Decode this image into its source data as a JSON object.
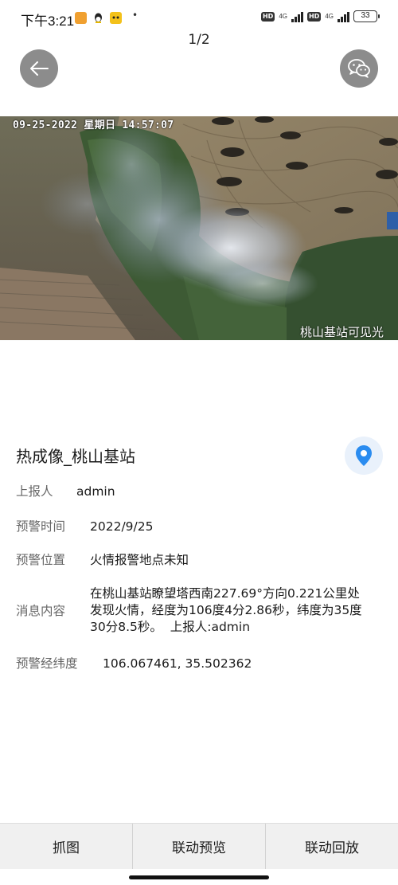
{
  "status_bar": {
    "time": "下午3:21",
    "dot": "•",
    "hd1": "HD",
    "net1": "4G",
    "hd2": "HD",
    "net2": "4G",
    "battery": "33"
  },
  "header": {
    "page_indicator": "1/2",
    "back_icon": "arrow-left-icon",
    "share_icon": "wechat-icon"
  },
  "photo": {
    "osd_timestamp": "09-25-2022 星期日 14:57:07",
    "camera_label": "桃山基站可见光"
  },
  "detail": {
    "title": "热成像_桃山基站",
    "location_icon": "map-pin-icon",
    "accent": "#2a8cf0",
    "reporter_label": "上报人",
    "reporter_value": "admin",
    "time_label": "预警时间",
    "time_value": "2022/9/25",
    "position_label": "预警位置",
    "position_value": "火情报警地点未知",
    "message_label": "消息内容",
    "message_line1": "在桃山基站瞭望塔西南227.69°方向0.221公里处",
    "message_line2": "发现火情，经度为106度4分2.86秒，纬度为35度",
    "message_line3": "30分8.5秒。  上报人:admin",
    "coords_label": "预警经纬度",
    "coords_value": "106.067461, 35.502362"
  },
  "bottom_bar": {
    "capture": "抓图",
    "linked_preview": "联动预览",
    "linked_playback": "联动回放"
  }
}
